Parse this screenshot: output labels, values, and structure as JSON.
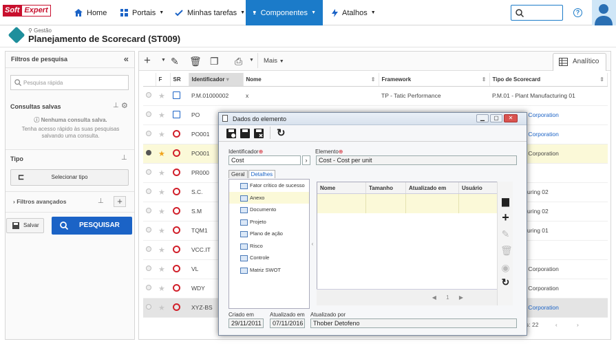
{
  "app": {
    "logo_a": "Soft",
    "logo_b": "Expert"
  },
  "nav": {
    "home": "Home",
    "portais": "Portais",
    "tarefas": "Minhas tarefas",
    "componentes": "Componentes",
    "atalhos": "Atalhos",
    "help": "?"
  },
  "header": {
    "breadcrumb": "Gestão",
    "title": "Planejamento de Scorecard (ST009)"
  },
  "left": {
    "title": "Filtros de pesquisa",
    "collapse": "«",
    "quick_search_placeholder": "Pesquisa rápida",
    "saved_title": "Consultas salvas",
    "saved_empty": "Nenhuma consulta salva.",
    "saved_hint_1": "Tenha acesso rápido às suas pesquisas",
    "saved_hint_2": "salvando uma consulta.",
    "type_title": "Tipo",
    "select_type": "Selecionar tipo",
    "advanced": "Filtros avançados",
    "save": "Salvar",
    "search": "PESQUISAR"
  },
  "toolbar": {
    "more": "Mais",
    "tab_analitico": "Analítico"
  },
  "grid": {
    "headers": [
      "F",
      "SR",
      "Identificador",
      "Nome",
      "Framework",
      "Tipo de Scorecard"
    ],
    "rows": [
      {
        "id": "P.M.01000002",
        "name": "x",
        "framework": "TP - Tatic Performance",
        "type": "P.M.01 - Plant Manufacturing 01",
        "fav": false,
        "sr": "doc",
        "selected": false
      },
      {
        "id": "PO",
        "name": "",
        "framework": "",
        "type": "oration - XYZ Corporation",
        "fav": false,
        "sr": "doc",
        "selected": false
      },
      {
        "id": "PO001",
        "name": "",
        "framework": "",
        "type": "oration - XYZ Corporation",
        "fav": false,
        "sr": "cycle",
        "selected": false
      },
      {
        "id": "PO001",
        "name": "",
        "framework": "",
        "type": "oration - XYZ Corporation",
        "fav": true,
        "sr": "cycle",
        "selected": true
      },
      {
        "id": "PR000",
        "name": "",
        "framework": "",
        "type": "uction",
        "fav": false,
        "sr": "cycle",
        "selected": false
      },
      {
        "id": "S.C.",
        "name": "",
        "framework": "",
        "type": "lant Manufacturing 02",
        "fav": false,
        "sr": "cycle",
        "selected": false
      },
      {
        "id": "S.M",
        "name": "",
        "framework": "",
        "type": "lant Manufacturing 02",
        "fav": false,
        "sr": "cycle",
        "selected": false
      },
      {
        "id": "TQM1",
        "name": "",
        "framework": "",
        "type": "lant Manufacturing 01",
        "fav": false,
        "sr": "cycle",
        "selected": false
      },
      {
        "id": "VCC.IT",
        "name": "",
        "framework": "",
        "type": "artment",
        "fav": false,
        "sr": "cycle",
        "selected": false
      },
      {
        "id": "VL",
        "name": "",
        "framework": "",
        "type": "oration - XYZ Corporation",
        "fav": false,
        "sr": "cycle",
        "selected": false
      },
      {
        "id": "WDY",
        "name": "",
        "framework": "",
        "type": "oration - XYZ Corporation",
        "fav": false,
        "sr": "cycle",
        "selected": false
      },
      {
        "id": "XYZ-BS",
        "name": "",
        "framework": "",
        "type": "oration - XYZ Corporation",
        "fav": false,
        "sr": "cycle",
        "selected": false
      }
    ],
    "total": "s: 22"
  },
  "dialog": {
    "title": "Dados do elemento",
    "id_label": "Identificador",
    "id_value": "Cost",
    "elem_label": "Elemento",
    "elem_value": "Cost - Cost per unit",
    "tab_geral": "Geral",
    "tab_detalhes": "Detalhes",
    "tree": [
      "Fator crítico de sucesso",
      "Anexo",
      "Documento",
      "Projeto",
      "Plano de ação",
      "Risco",
      "Controle",
      "Matriz SWOT"
    ],
    "cols": [
      "Nome",
      "Tamanho",
      "Atualizado em",
      "Usuário"
    ],
    "page": "1",
    "created_label": "Criado em",
    "created_value": "29/11/2011",
    "updated_label": "Atualizado em",
    "updated_value": "07/11/2016",
    "updated_by_label": "Atualizado por",
    "updated_by_value": "Thober Detofeno"
  },
  "colors": {
    "accent": "#1b7bc9",
    "search_btn": "#1b63c6",
    "selected_row": "#fbf9d8",
    "sr_red": "#d11f2a"
  }
}
